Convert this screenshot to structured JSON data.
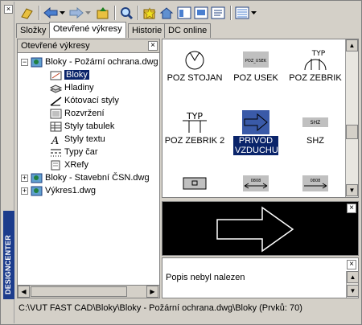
{
  "window": {
    "title_vertical": "DESIGNCENTER",
    "close_glyph": "×"
  },
  "toolbar": {
    "buttons": [
      "load-icon",
      "back-icon",
      "back-dropdown-icon",
      "forward-icon",
      "forward-dropdown-icon",
      "up-icon",
      "search-icon",
      "favorites-icon",
      "home-icon",
      "tree-toggle-icon",
      "preview-icon",
      "description-icon",
      "views-icon",
      "views-dropdown-icon"
    ]
  },
  "tabs": [
    {
      "label": "Složky",
      "active": false
    },
    {
      "label": "Otevřené výkresy",
      "active": true
    },
    {
      "label": "Historie",
      "active": false
    },
    {
      "label": "DC online",
      "active": false
    }
  ],
  "tree": {
    "header": "Otevřené výkresy",
    "nodes": [
      {
        "label": "Bloky - Požární ochrana.dwg",
        "expand": "−"
      },
      {
        "label": "Bloky",
        "selected": true
      },
      {
        "label": "Hladiny"
      },
      {
        "label": "Kótovací styly"
      },
      {
        "label": "Rozvržení"
      },
      {
        "label": "Styly tabulek"
      },
      {
        "label": "Styly textu"
      },
      {
        "label": "Typy čar"
      },
      {
        "label": "XRefy"
      },
      {
        "label": "Bloky - Stavební ČSN.dwg",
        "expand": "+"
      },
      {
        "label": "Výkres1.dwg",
        "expand": "+"
      }
    ]
  },
  "palette": {
    "items": [
      {
        "label": "POZ STOJAN",
        "thumb": "stojan"
      },
      {
        "label": "POZ USEK",
        "thumb": "usek"
      },
      {
        "label": "POZ ZEBRIK",
        "thumb": "zebrik"
      },
      {
        "label": "POZ ZEBRIK 2",
        "thumb": "zebrik2"
      },
      {
        "label": "PRIVOD VZDUCHU",
        "thumb": "privod",
        "selected": true
      },
      {
        "label": "SHZ",
        "thumb": "shz"
      },
      {
        "label": "",
        "thumb": "box"
      },
      {
        "label": "",
        "thumb": "arrow1"
      },
      {
        "label": "",
        "thumb": "arrow2"
      }
    ],
    "thumb_small_text": {
      "usek": "POZ_USEK",
      "zebrik": "TYP",
      "zebrik2": "TYP",
      "shz": "SHZ",
      "arrow1": "0808",
      "arrow2": "0808"
    }
  },
  "preview": {
    "shape": "arrow-outline"
  },
  "description": {
    "text": "Popis nebyl nalezen"
  },
  "status": {
    "text": "C:\\VUT FAST CAD\\Bloky\\Bloky - Požární ochrana.dwg\\Bloky (Prvků: 70)"
  },
  "colors": {
    "accent": "#0a246a",
    "titlebar": "#1c3c8c",
    "face": "#d4d0c8"
  }
}
